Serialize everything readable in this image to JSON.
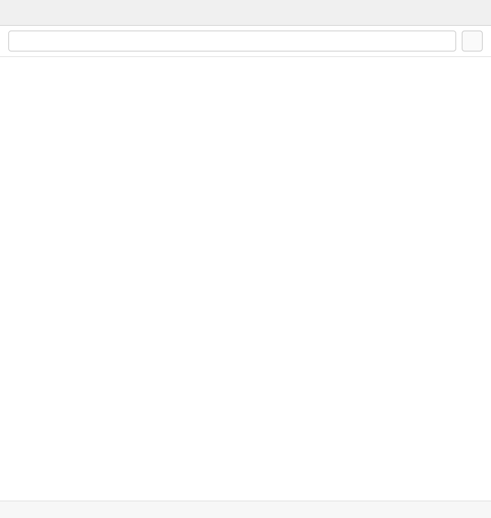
{
  "window": {
    "title": ""
  },
  "toolbar": {
    "search_placeholder": "",
    "action_label": ""
  },
  "content": {
    "message": ""
  },
  "status": {
    "text": ""
  }
}
